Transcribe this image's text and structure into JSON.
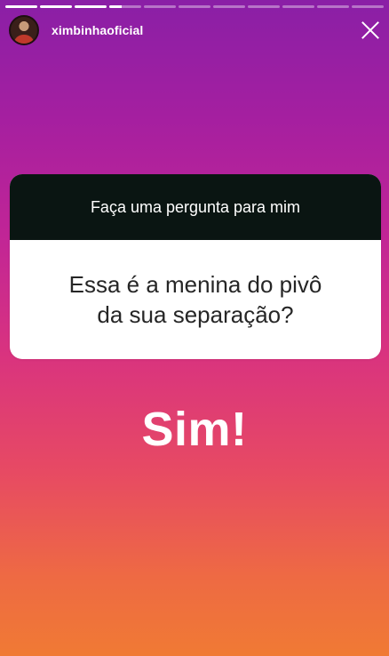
{
  "story": {
    "username": "ximbinhaoficial",
    "progress_segments": [
      1,
      1,
      1,
      0.4,
      0,
      0,
      0,
      0,
      0,
      0,
      0
    ],
    "colors": {
      "gradient_top": "#8a1fa6",
      "gradient_bottom": "#f07a34"
    }
  },
  "question_card": {
    "prompt": "Faça uma pergunta para mim",
    "question_line1": "Essa é a menina do pivô",
    "question_line2": "da sua separação?"
  },
  "answer": {
    "text": "Sim!"
  },
  "icons": {
    "close": "close-icon"
  }
}
